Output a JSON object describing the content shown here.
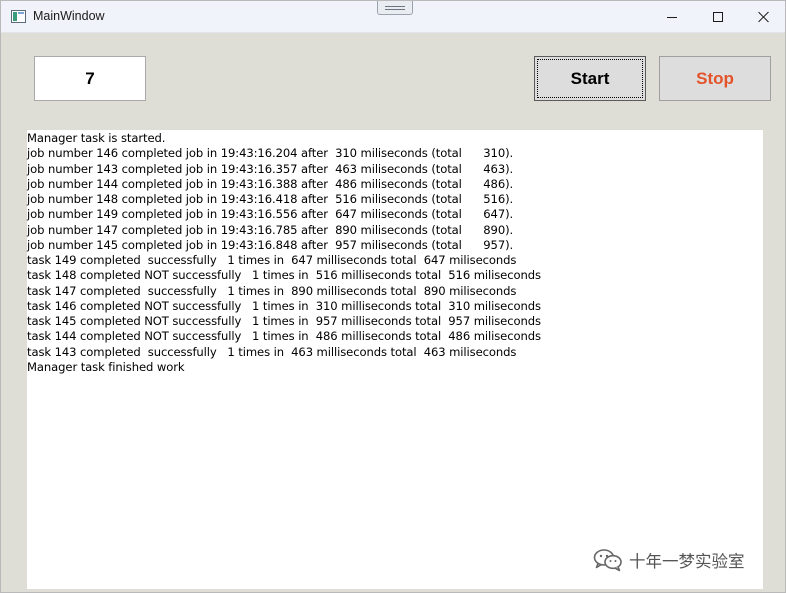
{
  "window": {
    "title": "MainWindow",
    "icons": {
      "app": "app-window-icon",
      "minimize": "minimize-icon",
      "maximize": "maximize-icon",
      "close": "close-icon"
    }
  },
  "toolbar": {
    "count_value": "7",
    "start_label": "Start",
    "stop_label": "Stop",
    "stop_color": "#e4532a"
  },
  "log": {
    "lines": [
      "Manager task is started.",
      "job number 146 completed job in 19:43:16.204 after  310 miliseconds (total      310).",
      "job number 143 completed job in 19:43:16.357 after  463 miliseconds (total      463).",
      "job number 144 completed job in 19:43:16.388 after  486 miliseconds (total      486).",
      "job number 148 completed job in 19:43:16.418 after  516 miliseconds (total      516).",
      "job number 149 completed job in 19:43:16.556 after  647 miliseconds (total      647).",
      "job number 147 completed job in 19:43:16.785 after  890 miliseconds (total      890).",
      "job number 145 completed job in 19:43:16.848 after  957 miliseconds (total      957).",
      "task 149 completed  successfully   1 times in  647 milliseconds total  647 miliseconds",
      "task 148 completed NOT successfully   1 times in  516 milliseconds total  516 miliseconds",
      "task 147 completed  successfully   1 times in  890 milliseconds total  890 miliseconds",
      "task 146 completed NOT successfully   1 times in  310 milliseconds total  310 miliseconds",
      "task 145 completed NOT successfully   1 times in  957 milliseconds total  957 miliseconds",
      "task 144 completed NOT successfully   1 times in  486 milliseconds total  486 miliseconds",
      "task 143 completed  successfully   1 times in  463 milliseconds total  463 miliseconds",
      "Manager task finished work"
    ]
  },
  "watermark": {
    "text": "十年一梦实验室",
    "icon": "wechat-icon"
  }
}
